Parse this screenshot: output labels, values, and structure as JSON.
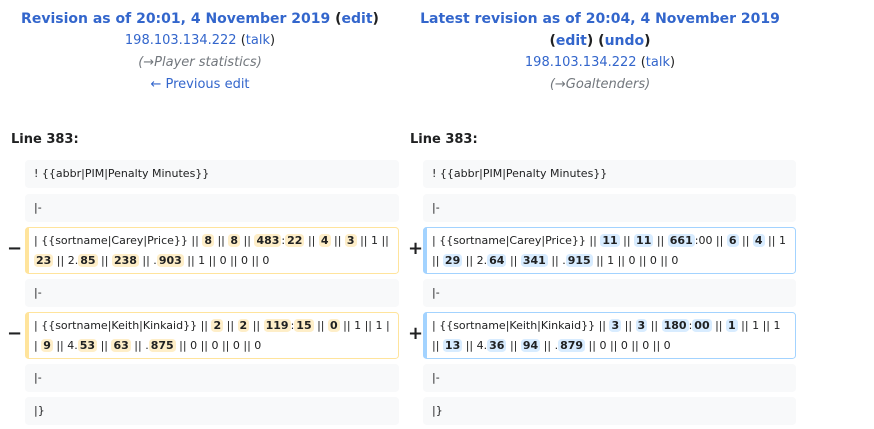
{
  "header": {
    "left": {
      "title": "Revision as of 20:01, 4 November 2019",
      "edit_label": "edit",
      "user": "198.103.134.222",
      "talk_label": "talk",
      "summary_arrow": "→",
      "summary_section": "Player statistics",
      "prev_edit_label": "← Previous edit"
    },
    "right": {
      "title": "Latest revision as of 20:04, 4 November 2019",
      "edit_label": "edit",
      "undo_label": "undo",
      "user": "198.103.134.222",
      "talk_label": "talk",
      "summary_arrow": "→",
      "summary_section": "Goaltenders"
    }
  },
  "line_label_left": "Line 383:",
  "line_label_right": "Line 383:",
  "context": {
    "pim": "! {{abbr|PIM|Penalty Minutes}}",
    "sep1": "|-",
    "sep2": "|-",
    "sep3": "|-",
    "end": "|}"
  },
  "markers": {
    "minus": "−",
    "plus": "+"
  },
  "rows": {
    "price_old": [
      {
        "t": "| {{sortname|Carey|Price}} || "
      },
      {
        "t": "8",
        "h": 1
      },
      {
        "t": " || "
      },
      {
        "t": "8",
        "h": 1
      },
      {
        "t": " || "
      },
      {
        "t": "483",
        "h": 1
      },
      {
        "t": ":"
      },
      {
        "t": "22",
        "h": 1
      },
      {
        "t": " || "
      },
      {
        "t": "4",
        "h": 1
      },
      {
        "t": " || "
      },
      {
        "t": "3",
        "h": 1
      },
      {
        "t": " || 1 || "
      },
      {
        "t": "23",
        "h": 1
      },
      {
        "t": " || 2."
      },
      {
        "t": "85",
        "h": 1
      },
      {
        "t": " || "
      },
      {
        "t": "238",
        "h": 1
      },
      {
        "t": " || ."
      },
      {
        "t": "903",
        "h": 1
      },
      {
        "t": " || 1 || 0 || 0 || 0"
      }
    ],
    "price_new": [
      {
        "t": "| {{sortname|Carey|Price}} || "
      },
      {
        "t": "11",
        "h": 1
      },
      {
        "t": " || "
      },
      {
        "t": "11",
        "h": 1
      },
      {
        "t": " || "
      },
      {
        "t": "661",
        "h": 1
      },
      {
        "t": ":00"
      },
      {
        "t": " || "
      },
      {
        "t": "6",
        "h": 1
      },
      {
        "t": " || "
      },
      {
        "t": "4",
        "h": 1
      },
      {
        "t": " || 1 || "
      },
      {
        "t": "29",
        "h": 1
      },
      {
        "t": " || 2."
      },
      {
        "t": "64",
        "h": 1
      },
      {
        "t": " || "
      },
      {
        "t": "341",
        "h": 1
      },
      {
        "t": " || ."
      },
      {
        "t": "915",
        "h": 1
      },
      {
        "t": " || 1 || 0 || 0 || 0"
      }
    ],
    "kinkaid_old": [
      {
        "t": "| {{sortname|Keith|Kinkaid}} || "
      },
      {
        "t": "2",
        "h": 1
      },
      {
        "t": " || "
      },
      {
        "t": "2",
        "h": 1
      },
      {
        "t": " || "
      },
      {
        "t": "119",
        "h": 1
      },
      {
        "t": ":"
      },
      {
        "t": "15",
        "h": 1
      },
      {
        "t": " || "
      },
      {
        "t": "0",
        "h": 1
      },
      {
        "t": " || 1 || 1 || "
      },
      {
        "t": "9",
        "h": 1
      },
      {
        "t": " || 4."
      },
      {
        "t": "53",
        "h": 1
      },
      {
        "t": " || "
      },
      {
        "t": "63",
        "h": 1
      },
      {
        "t": " || ."
      },
      {
        "t": "875",
        "h": 1
      },
      {
        "t": " || 0 || 0 || 0 || 0"
      }
    ],
    "kinkaid_new": [
      {
        "t": "| {{sortname|Keith|Kinkaid}} || "
      },
      {
        "t": "3",
        "h": 1
      },
      {
        "t": " || "
      },
      {
        "t": "3",
        "h": 1
      },
      {
        "t": " || "
      },
      {
        "t": "180",
        "h": 1
      },
      {
        "t": ":"
      },
      {
        "t": "00",
        "h": 1
      },
      {
        "t": " || "
      },
      {
        "t": "1",
        "h": 1
      },
      {
        "t": " || 1 || 1 || "
      },
      {
        "t": "13",
        "h": 1
      },
      {
        "t": " || 4."
      },
      {
        "t": "36",
        "h": 1
      },
      {
        "t": " || "
      },
      {
        "t": "94",
        "h": 1
      },
      {
        "t": " || ."
      },
      {
        "t": "879",
        "h": 1
      },
      {
        "t": " || 0 || 0 || 0 || 0"
      }
    ]
  },
  "colors": {
    "link": "#3366cc",
    "deleted_border": "#ffe49c",
    "deleted_highlight": "#feeec8",
    "added_border": "#a3d3ff",
    "added_highlight": "#d8ecff",
    "context_bg": "#f8f9fa"
  }
}
